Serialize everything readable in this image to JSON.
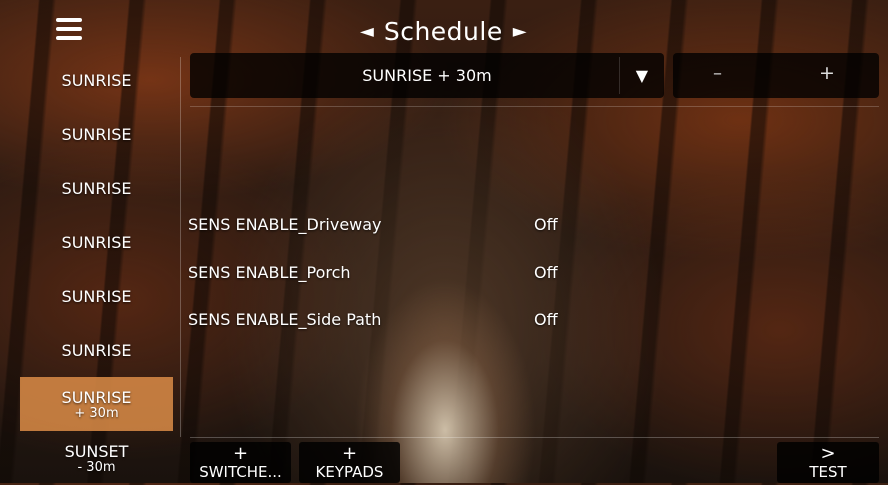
{
  "header": {
    "title": "Schedule",
    "prev_arrow": "◄",
    "next_arrow": "►",
    "menu_icon": "hamburger-menu-icon"
  },
  "sidebar": {
    "items": [
      {
        "label": "SUNRISE",
        "sub": ""
      },
      {
        "label": "SUNRISE",
        "sub": ""
      },
      {
        "label": "SUNRISE",
        "sub": ""
      },
      {
        "label": "SUNRISE",
        "sub": ""
      },
      {
        "label": "SUNRISE",
        "sub": ""
      },
      {
        "label": "SUNRISE",
        "sub": ""
      },
      {
        "label": "SUNRISE",
        "sub": "+ 30m",
        "active": true
      },
      {
        "label": "SUNSET",
        "sub": "- 30m"
      }
    ],
    "active_color": "#d68946"
  },
  "time_select": {
    "value": "SUNRISE + 30m",
    "caret": "▼"
  },
  "stepper": {
    "minus": "–",
    "plus": "+"
  },
  "rows": [
    {
      "name": "SENS ENABLE_Driveway",
      "value": "Off"
    },
    {
      "name": "SENS ENABLE_Porch",
      "value": "Off"
    },
    {
      "name": "SENS ENABLE_Side Path",
      "value": "Off"
    }
  ],
  "bottom_buttons": {
    "switches": {
      "symbol": "+",
      "label": "SWITCHE..."
    },
    "keypads": {
      "symbol": "+",
      "label": "KEYPADS"
    },
    "test": {
      "symbol": ">",
      "label": "TEST"
    }
  }
}
